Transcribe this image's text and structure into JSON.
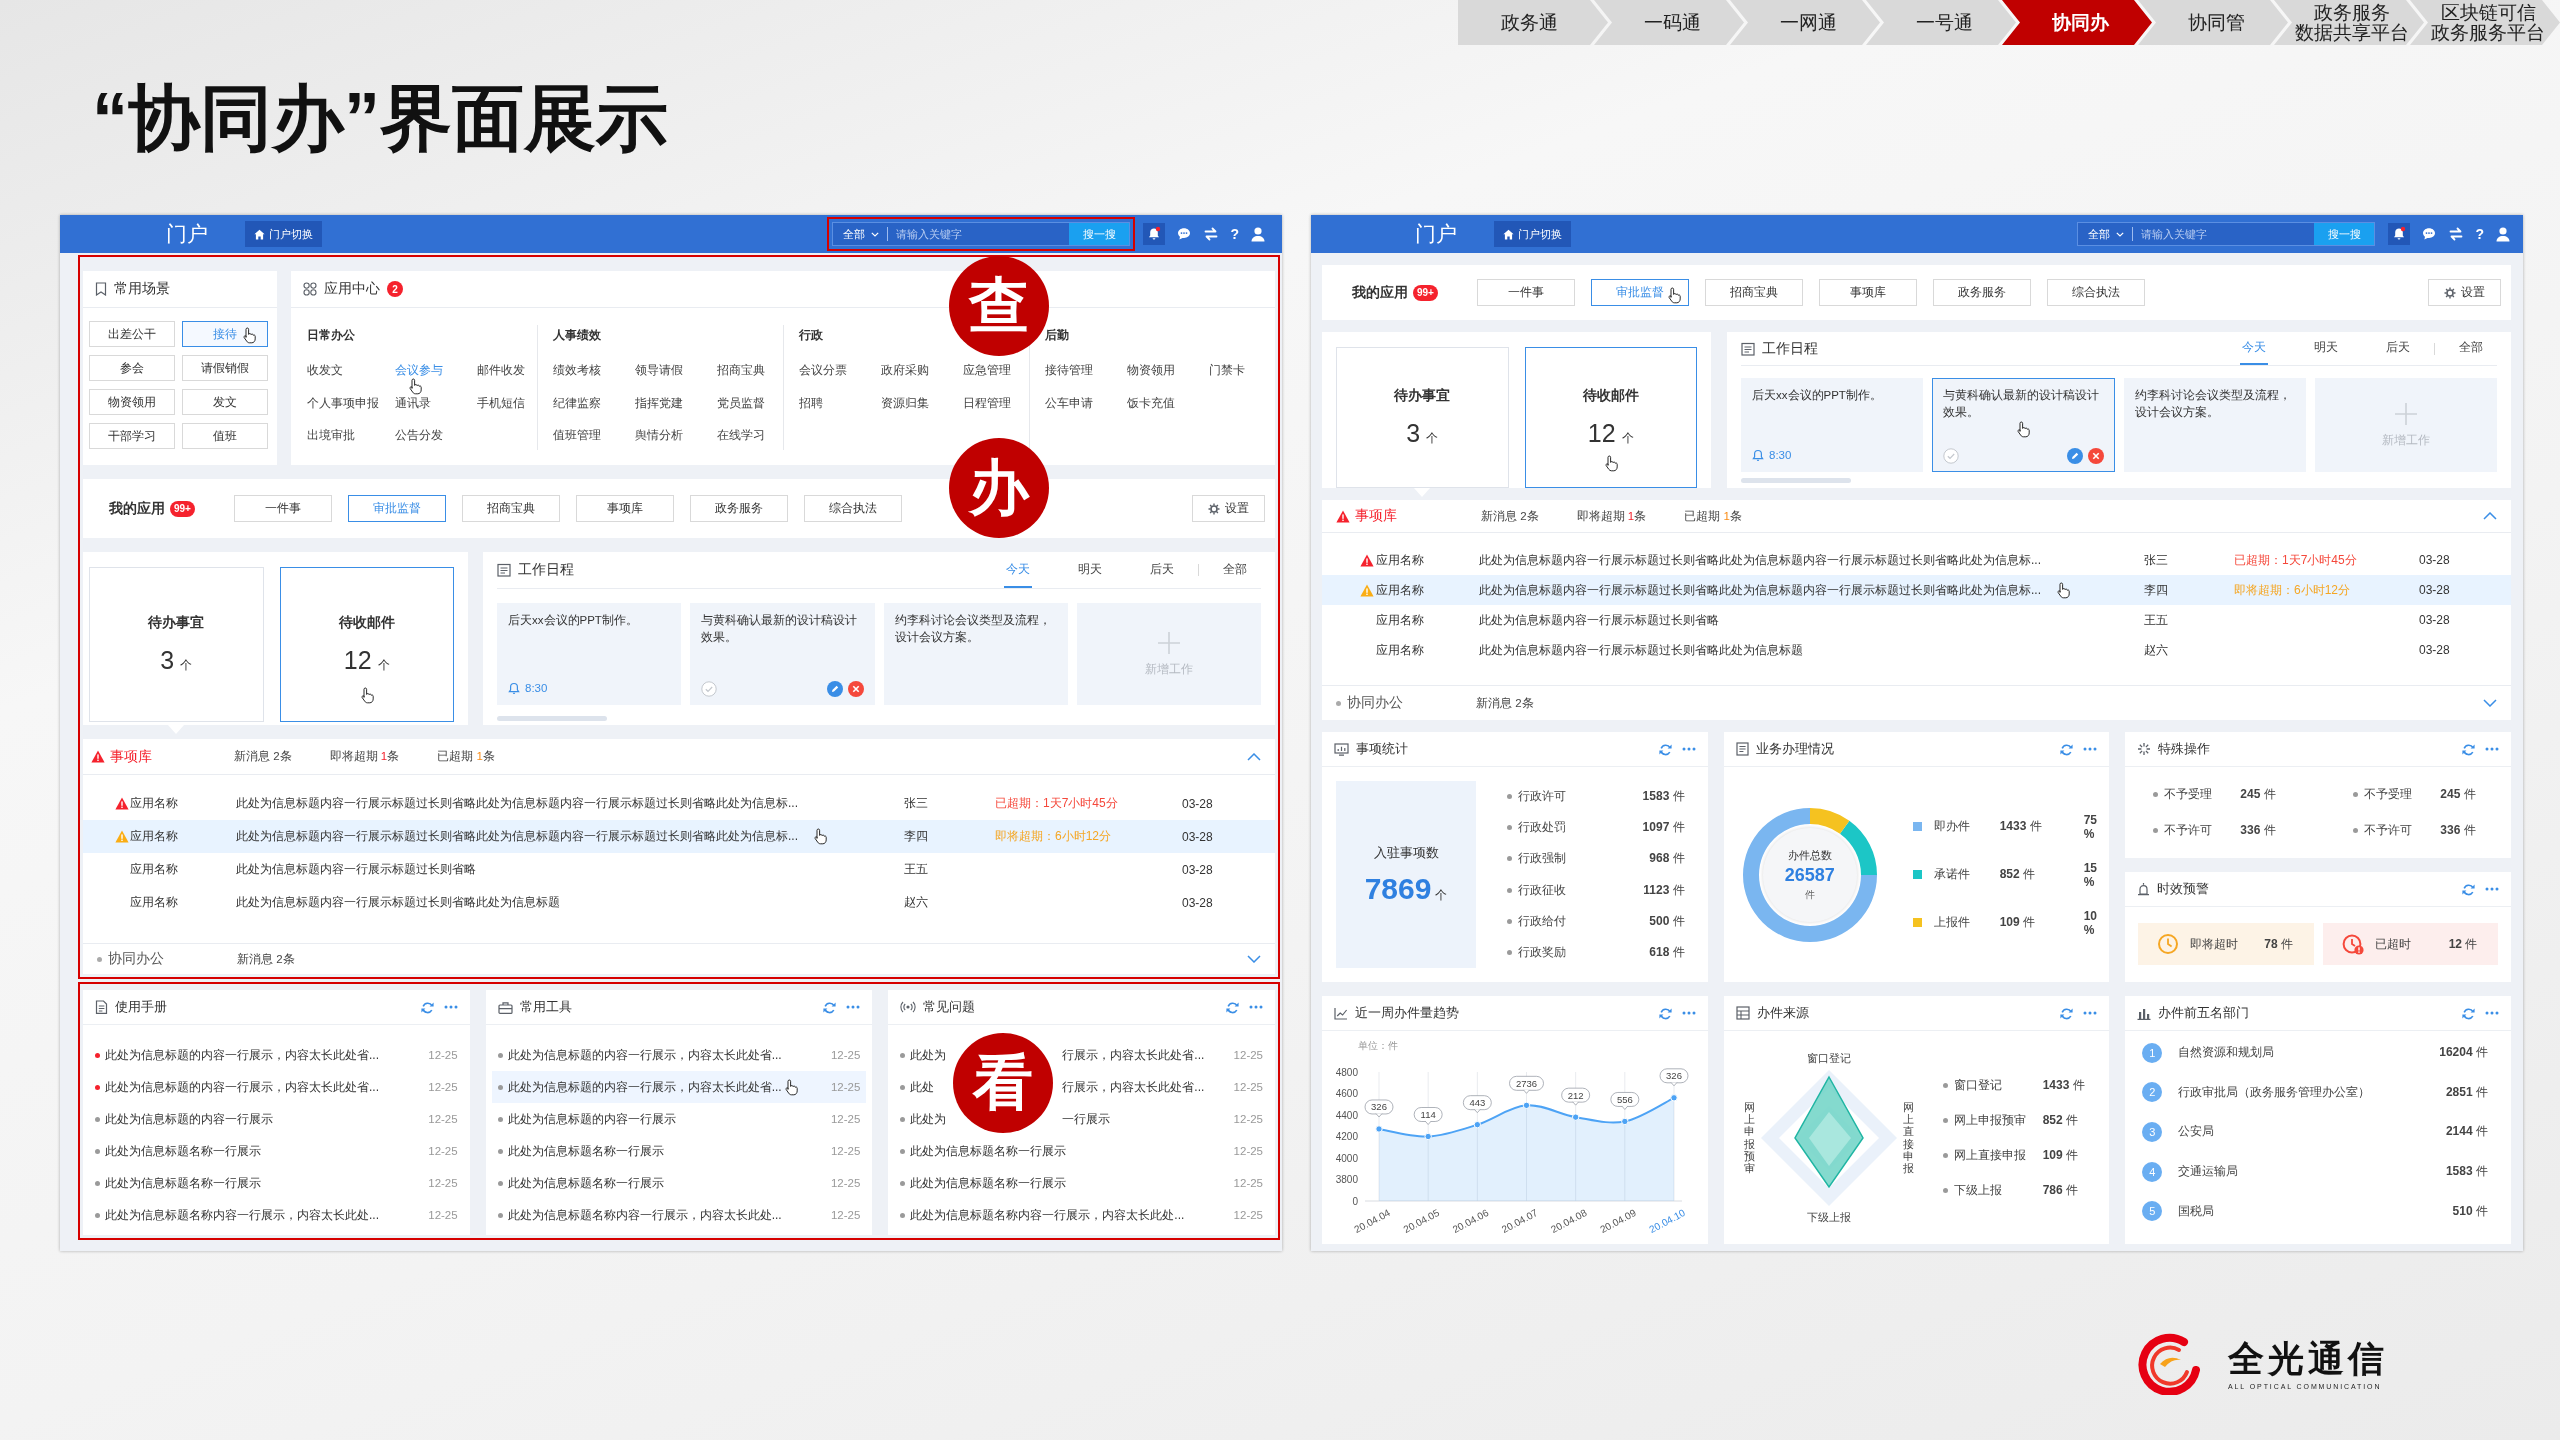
{
  "nav": [
    {
      "label": "政务通",
      "selected": false
    },
    {
      "label": "一码通",
      "selected": false
    },
    {
      "label": "一网通",
      "selected": false
    },
    {
      "label": "一号通",
      "selected": false
    },
    {
      "label": "协同办",
      "selected": true
    },
    {
      "label": "协同管",
      "selected": false
    },
    {
      "lines": [
        "政务服务",
        "数据共享平台"
      ],
      "selected": false
    },
    {
      "lines": [
        "区块链可信",
        "政务服务平台"
      ],
      "selected": false
    }
  ],
  "title": "“协同办”界面展示",
  "screens": [
    {
      "header": {
        "title": "门户",
        "switch": "门户切换",
        "scope": "全部",
        "placeholder": "请输入关键字",
        "search_button": "搜一搜",
        "help": "?"
      },
      "annotations": {
        "search": "查",
        "work": "办",
        "view": "看"
      },
      "scenes": {
        "title": "常用场景",
        "items": [
          {
            "label": "出差公干",
            "hover": false
          },
          {
            "label": "接待",
            "hover": true
          },
          {
            "label": "参会",
            "hover": false
          },
          {
            "label": "请假销假",
            "hover": false
          },
          {
            "label": "物资领用",
            "hover": false
          },
          {
            "label": "发文",
            "hover": false
          },
          {
            "label": "干部学习",
            "hover": false
          },
          {
            "label": "值班",
            "hover": false
          }
        ]
      },
      "app_center": {
        "title": "应用中心",
        "badge": "2",
        "groups": [
          {
            "title": "日常办公",
            "items": [
              {
                "label": "收发文",
                "hover": false
              },
              {
                "label": "会议参与",
                "hover": true
              },
              {
                "label": "邮件收发",
                "hover": false
              },
              {
                "label": "个人事项申报",
                "hover": false
              },
              {
                "label": "通讯录",
                "hover": false
              },
              {
                "label": "手机短信",
                "hover": false
              },
              {
                "label": "出境审批",
                "hover": false
              },
              {
                "label": "公告分发",
                "hover": false
              }
            ]
          },
          {
            "title": "人事绩效",
            "items": [
              {
                "label": "绩效考核",
                "hover": false
              },
              {
                "label": "领导请假",
                "hover": false
              },
              {
                "label": "招商宝典",
                "hover": false
              },
              {
                "label": "纪律监察",
                "hover": false
              },
              {
                "label": "指挥党建",
                "hover": false
              },
              {
                "label": "党员监督",
                "hover": false
              },
              {
                "label": "值班管理",
                "hover": false
              },
              {
                "label": "舆情分析",
                "hover": false
              },
              {
                "label": "在线学习",
                "hover": false
              }
            ]
          },
          {
            "title": "行政",
            "items": [
              {
                "label": "会议分票",
                "hover": false
              },
              {
                "label": "政府采购",
                "hover": false
              },
              {
                "label": "应急管理",
                "hover": false
              },
              {
                "label": "招聘",
                "hover": false
              },
              {
                "label": "资源归集",
                "hover": false
              },
              {
                "label": "日程管理",
                "hover": false
              }
            ]
          },
          {
            "title": "后勤",
            "items": [
              {
                "label": "接待管理",
                "hover": false
              },
              {
                "label": "物资领用",
                "hover": false
              },
              {
                "label": "门禁卡",
                "hover": false
              },
              {
                "label": "公车申请",
                "hover": false
              },
              {
                "label": "饭卡充值",
                "hover": false
              }
            ]
          }
        ]
      },
      "my_apps": {
        "title": "我的应用",
        "badge": "99+",
        "items": [
          {
            "label": "一件事",
            "selected": false
          },
          {
            "label": "审批监督",
            "selected": true
          },
          {
            "label": "招商宝典",
            "selected": false
          },
          {
            "label": "事项库",
            "selected": false
          },
          {
            "label": "政务服务",
            "selected": false
          },
          {
            "label": "综合执法",
            "selected": false
          }
        ],
        "settings": "设置"
      },
      "todo": [
        {
          "label": "待办事宜",
          "count": "3",
          "unit": "个",
          "selected": true,
          "hover": false
        },
        {
          "label": "待收邮件",
          "count": "12",
          "unit": "个",
          "selected": false,
          "hover": true
        }
      ],
      "schedule": {
        "title": "工作日程",
        "tabs": [
          {
            "label": "今天",
            "selected": true
          },
          {
            "label": "明天",
            "selected": false
          },
          {
            "label": "后天",
            "selected": false
          },
          {
            "label": "全部",
            "selected": false
          }
        ],
        "cards": [
          {
            "kind": "reminder",
            "text": "后天xx会议的PPT制作。",
            "time": "8:30"
          },
          {
            "kind": "actions",
            "text": "与黄科确认最新的设计稿设计效果。"
          },
          {
            "kind": "note",
            "text": "约李科讨论会议类型及流程，设计会议方案。"
          },
          {
            "kind": "add",
            "text": "新增工作"
          }
        ]
      },
      "matters": {
        "title": "事项库",
        "expanded": true,
        "summary": [
          {
            "kind": "new",
            "label": "新消息",
            "count": "2",
            "unit": "条"
          },
          {
            "kind": "due",
            "label": "即将超期",
            "count": "1",
            "unit": "条"
          },
          {
            "kind": "overdue",
            "label": "已超期",
            "count": "1",
            "unit": "条"
          }
        ],
        "rows": [
          {
            "kind": "overdue",
            "app": "应用名称",
            "title": "此处为信息标题内容一行展示标题过长则省略此处为信息标题内容一行展示标题过长则省略此处为信息标...",
            "person": "张三",
            "status": "已超期：1天7小时45分",
            "date": "03-28",
            "hover": false
          },
          {
            "kind": "due",
            "app": "应用名称",
            "title": "此处为信息标题内容一行展示标题过长则省略此处为信息标题内容一行展示标题过长则省略此处为信息标...",
            "person": "李四",
            "status": "即将超期：6小时12分",
            "date": "03-28",
            "hover": true
          },
          {
            "kind": "normal",
            "app": "应用名称",
            "title": "此处为信息标题内容一行展示标题过长则省略",
            "person": "王五",
            "date": "03-28",
            "hover": false
          },
          {
            "kind": "normal",
            "app": "应用名称",
            "title": "此处为信息标题内容一行展示标题过长则省略此处为信息标题",
            "person": "赵六",
            "date": "03-28",
            "hover": false
          }
        ],
        "footer": {
          "title": "协同办公",
          "summary": "新消息 2条",
          "expanded": false
        }
      },
      "info_cards": [
        {
          "kind": "manual",
          "title": "使用手册",
          "items": [
            {
              "text": "此处为信息标题的内容一行展示，内容太长此处省...",
              "date": "12-25",
              "new": true
            },
            {
              "text": "此处为信息标题的内容一行展示，内容太长此处省...",
              "date": "12-25",
              "new": true
            },
            {
              "text": "此处为信息标题的内容一行展示",
              "date": "12-25",
              "new": false
            },
            {
              "text": "此处为信息标题名称一行展示",
              "date": "12-25",
              "new": false
            },
            {
              "text": "此处为信息标题名称一行展示",
              "date": "12-25",
              "new": false
            },
            {
              "text": "此处为信息标题名称内容一行展示，内容太长此处...",
              "date": "12-25",
              "new": false
            }
          ]
        },
        {
          "kind": "tools",
          "title": "常用工具",
          "items": [
            {
              "text": "此处为信息标题的内容一行展示，内容太长此处省...",
              "date": "12-25",
              "hover": false
            },
            {
              "text": "此处为信息标题的内容一行展示，内容太长此处省...",
              "date": "12-25",
              "hover": true
            },
            {
              "text": "此处为信息标题的内容一行展示",
              "date": "12-25",
              "hover": false
            },
            {
              "text": "此处为信息标题名称一行展示",
              "date": "12-25",
              "hover": false
            },
            {
              "text": "此处为信息标题名称一行展示",
              "date": "12-25",
              "hover": false
            },
            {
              "text": "此处为信息标题名称内容一行展示，内容太长此处...",
              "date": "12-25",
              "hover": false
            }
          ]
        },
        {
          "kind": "faq",
          "title": "常见问题",
          "items": [
            {
              "text": "此处为",
              "text_after": "行展示，内容太长此处省...",
              "date": "12-25"
            },
            {
              "text": "此处",
              "text_after": "行展示，内容太长此处省...",
              "date": "12-25"
            },
            {
              "text": "此处为",
              "text_after": "一行展示",
              "date": "12-25"
            },
            {
              "text": "此处为信息标题名称一行展示",
              "date": "12-25"
            },
            {
              "text": "此处为信息标题名称一行展示",
              "date": "12-25"
            },
            {
              "text": "此处为信息标题名称内容一行展示，内容太长此处...",
              "date": "12-25"
            }
          ]
        }
      ]
    },
    {
      "header": {
        "title": "门户",
        "switch": "门户切换",
        "scope": "全部",
        "placeholder": "请输入关键字",
        "search_button": "搜一搜",
        "help": "?"
      },
      "my_apps": {
        "title": "我的应用",
        "badge": "99+",
        "items": [
          {
            "label": "一件事",
            "selected": false,
            "hover": false
          },
          {
            "label": "审批监督",
            "selected": true,
            "hover": true
          },
          {
            "label": "招商宝典",
            "selected": false,
            "hover": false
          },
          {
            "label": "事项库",
            "selected": false,
            "hover": false
          },
          {
            "label": "政务服务",
            "selected": false,
            "hover": false
          },
          {
            "label": "综合执法",
            "selected": false,
            "hover": false
          }
        ],
        "settings": "设置"
      },
      "todo": [
        {
          "label": "待办事宜",
          "count": "3",
          "unit": "个",
          "selected": true,
          "hover": false
        },
        {
          "label": "待收邮件",
          "count": "12",
          "unit": "个",
          "selected": false,
          "hover": true
        }
      ],
      "schedule": {
        "title": "工作日程",
        "tabs": [
          {
            "label": "今天",
            "selected": true
          },
          {
            "label": "明天",
            "selected": false
          },
          {
            "label": "后天",
            "selected": false
          },
          {
            "label": "全部",
            "selected": false
          }
        ],
        "cards": [
          {
            "kind": "reminder",
            "text": "后天xx会议的PPT制作。",
            "time": "8:30",
            "hover": false
          },
          {
            "kind": "actions",
            "text": "与黄科确认最新的设计稿设计效果。",
            "hover": true
          },
          {
            "kind": "note",
            "text": "约李科讨论会议类型及流程，设计会议方案。",
            "hover": false
          },
          {
            "kind": "add",
            "text": "新增工作",
            "hover": false
          }
        ]
      },
      "matters": {
        "title": "事项库",
        "expanded": true,
        "summary": [
          {
            "kind": "new",
            "label": "新消息",
            "count": "2",
            "unit": "条"
          },
          {
            "kind": "due",
            "label": "即将超期",
            "count": "1",
            "unit": "条"
          },
          {
            "kind": "overdue",
            "label": "已超期",
            "count": "1",
            "unit": "条"
          }
        ],
        "rows": [
          {
            "kind": "overdue",
            "app": "应用名称",
            "title": "此处为信息标题内容一行展示标题过长则省略此处为信息标题内容一行展示标题过长则省略此处为信息标...",
            "person": "张三",
            "status": "已超期：1天7小时45分",
            "date": "03-28",
            "hover": false
          },
          {
            "kind": "due",
            "app": "应用名称",
            "title": "此处为信息标题内容一行展示标题过长则省略此处为信息标题内容一行展示标题过长则省略此处为信息标...",
            "person": "李四",
            "status": "即将超期：6小时12分",
            "date": "03-28",
            "hover": true
          },
          {
            "kind": "normal",
            "app": "应用名称",
            "title": "此处为信息标题内容一行展示标题过长则省略",
            "person": "王五",
            "date": "03-28",
            "hover": false
          },
          {
            "kind": "normal",
            "app": "应用名称",
            "title": "此处为信息标题内容一行展示标题过长则省略此处为信息标题",
            "person": "赵六",
            "date": "03-28",
            "hover": false
          }
        ],
        "footer": {
          "title": "协同办公",
          "summary": "新消息 2条",
          "expanded": false
        }
      },
      "dashboard": [
        {
          "kind": "stats",
          "title": "事项统计",
          "total_label": "入驻事项数",
          "total": "7869",
          "total_unit": "个",
          "items": [
            {
              "label": "行政许可",
              "value": "1583",
              "unit": "件"
            },
            {
              "label": "行政处罚",
              "value": "1097",
              "unit": "件"
            },
            {
              "label": "行政强制",
              "value": "968",
              "unit": "件"
            },
            {
              "label": "行政征收",
              "value": "1123",
              "unit": "件"
            },
            {
              "label": "行政给付",
              "value": "500",
              "unit": "件"
            },
            {
              "label": "行政奖励",
              "value": "618",
              "unit": "件"
            }
          ]
        },
        {
          "kind": "handling",
          "title": "业务办理情况",
          "center_label": "办件总数",
          "center_value": "26587",
          "center_unit": "件",
          "legend": [
            {
              "value": "1433",
              "unit": "件",
              "percent": "75 %",
              "color": "#7ab6f0"
            },
            {
              "value": "852",
              "unit": "件",
              "percent": "15 %",
              "color": "#1cc6c6"
            },
            {
              "value": "109",
              "unit": "件",
              "percent": "10 %",
              "color": "#f5c220"
            }
          ],
          "chart_data": {
            "type": "donut",
            "categories": [
              "即办件",
              "承诺件",
              "上报件"
            ],
            "values": [
              75,
              15,
              10
            ]
          }
        },
        {
          "kind": "special",
          "title": "特殊操作",
          "items": [
            {
              "label": "不予受理",
              "value": "245",
              "unit": "件"
            },
            {
              "label": "不予受理",
              "value": "245",
              "unit": "件"
            },
            {
              "label": "不予许可",
              "value": "336",
              "unit": "件"
            },
            {
              "label": "不予许可",
              "value": "336",
              "unit": "件"
            }
          ]
        },
        {
          "kind": "warning",
          "title": "时效预警",
          "items": [
            {
              "kind": "soon",
              "label": "即将超时",
              "value": "78",
              "unit": "件"
            },
            {
              "kind": "over",
              "label": "已超时",
              "value": "12",
              "unit": "件"
            }
          ]
        },
        {
          "kind": "trend",
          "title": "近一周办件量趋势",
          "unit_label": "单位：件",
          "baseline_label": "0",
          "x_selected": [
            false,
            false,
            false,
            false,
            false,
            false,
            true
          ],
          "chart_data": {
            "type": "area",
            "x": [
              "20.04.04",
              "20.04.05",
              "20.04.06",
              "20.04.07",
              "20.04.08",
              "20.04.09",
              "20.04.10"
            ],
            "series": [
              {
                "color": "#4da3f5",
                "values": [
                  4270,
                  4200,
                  4310,
                  4490,
                  4380,
                  4340,
                  4560
                ]
              }
            ],
            "ylim": [
              3600,
              4800
            ],
            "yticks": [
              3800,
              4000,
              4200,
              4400,
              4600,
              4800
            ],
            "grid": true,
            "value_labels": [
              "326",
              "114",
              "443",
              "2736",
              "212",
              "556",
              "326"
            ]
          }
        },
        {
          "kind": "source",
          "title": "办件来源",
          "axes": [
            "窗口登记",
            "网上直接申报",
            "下级上报",
            "网上申报预审"
          ],
          "legend": [
            {
              "label": "窗口登记",
              "value": "1433",
              "unit": "件"
            },
            {
              "label": "网上申报预审",
              "value": "852",
              "unit": "件"
            },
            {
              "label": "网上直接申报",
              "value": "109",
              "unit": "件"
            },
            {
              "label": "下级上报",
              "value": "786",
              "unit": "件"
            }
          ]
        },
        {
          "kind": "ranking",
          "title": "办件前五名部门",
          "items": [
            {
              "rank": "1",
              "name": "自然资源和规划局",
              "value": "16204",
              "unit": "件"
            },
            {
              "rank": "2",
              "name": "行政审批局（政务服务管理办公室）",
              "value": "2851",
              "unit": "件"
            },
            {
              "rank": "3",
              "name": "公安局",
              "value": "2144",
              "unit": "件"
            },
            {
              "rank": "4",
              "name": "交通运输局",
              "value": "1583",
              "unit": "件"
            },
            {
              "rank": "5",
              "name": "国税局",
              "value": "510",
              "unit": "件"
            }
          ]
        }
      ]
    }
  ],
  "logo": {
    "name": "全光通信",
    "tagline": "ALL OPTICAL COMMUNICATION"
  }
}
